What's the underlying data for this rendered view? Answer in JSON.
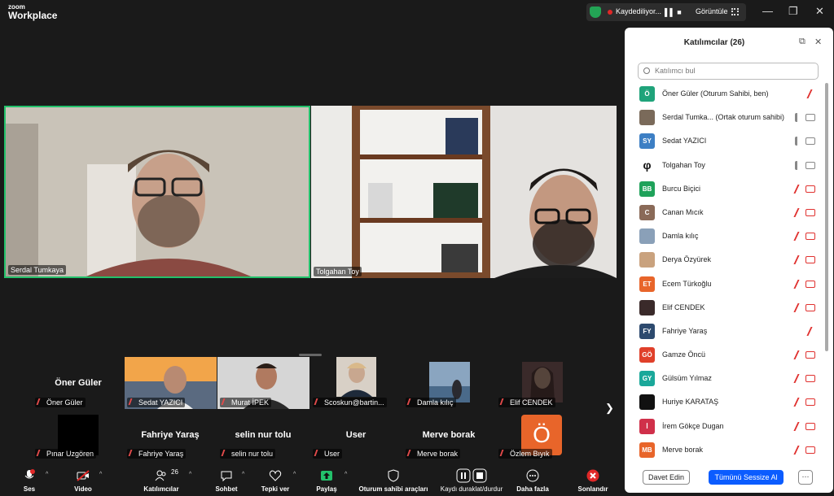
{
  "app": {
    "logo_top": "zoom",
    "logo_bottom": "Workplace"
  },
  "titlebar": {
    "recording": "Kaydediliyor...",
    "recording_controls": "▌▌ ■",
    "view_label": "Görüntüle"
  },
  "main_tiles": [
    {
      "name": "Serdal Tumkaya"
    },
    {
      "name": "Tolgahan Toy"
    }
  ],
  "thumbs_row1": [
    {
      "name": "Öner Güler",
      "big_name": "Öner Güler"
    },
    {
      "name": "Sedat YAZICI"
    },
    {
      "name": "Murat İPEK"
    },
    {
      "name": "Scoskun@bartin..."
    },
    {
      "name": "Damla kılıç"
    },
    {
      "name": "Elif CENDEK"
    }
  ],
  "thumbs_row2": [
    {
      "name": "Pınar Uzgören"
    },
    {
      "name": "Fahriye Yaraş",
      "big_name": "Fahriye Yaraş"
    },
    {
      "name": "selin nur tolu",
      "big_name": "selin nur tolu"
    },
    {
      "name": "User",
      "big_name": "User"
    },
    {
      "name": "Merve borak",
      "big_name": "Merve borak"
    },
    {
      "name": "Özlem Bıyık",
      "avatar_letter": "Ö"
    }
  ],
  "panel": {
    "title": "Katılımcılar (26)",
    "search_placeholder": "Katılımcı bul",
    "invite_label": "Davet Edin",
    "mute_all_label": "Tümünü Sessize Al",
    "more_label": "···",
    "participants": [
      {
        "name": "Öner Güler (Oturum Sahibi, ben)",
        "initials": "Ö",
        "color": "#1fa37a",
        "mic": "off",
        "cam": "none"
      },
      {
        "name": "Serdal Tumka...  (Ortak oturum sahibi)",
        "initials": "",
        "color": "#7a6a5a",
        "mic": "on",
        "cam": "on"
      },
      {
        "name": "Sedat YAZICI",
        "initials": "SY",
        "color": "#3d7fc4",
        "mic": "on",
        "cam": "on"
      },
      {
        "name": "Tolgahan Toy",
        "initials": "φ",
        "color": "#ffffff",
        "mic": "on",
        "cam": "on"
      },
      {
        "name": "Burcu Biçici",
        "initials": "BB",
        "color": "#1fa25a",
        "mic": "off",
        "cam": "off"
      },
      {
        "name": "Canan Mıcık",
        "initials": "C",
        "color": "#8a6a58",
        "mic": "off",
        "cam": "off"
      },
      {
        "name": "Damla kılıç",
        "initials": "",
        "color": "#8aa0b8",
        "mic": "off",
        "cam": "off"
      },
      {
        "name": "Derya Özyürek",
        "initials": "",
        "color": "#c9a27e",
        "mic": "off",
        "cam": "off"
      },
      {
        "name": "Ecem Türkoğlu",
        "initials": "ET",
        "color": "#e8652a",
        "mic": "off",
        "cam": "off"
      },
      {
        "name": "Elif CENDEK",
        "initials": "",
        "color": "#3a2a2a",
        "mic": "off",
        "cam": "off"
      },
      {
        "name": "Fahriye Yaraş",
        "initials": "FY",
        "color": "#2d4a6e",
        "mic": "off",
        "cam": "none"
      },
      {
        "name": "Gamze Öncü",
        "initials": "GÖ",
        "color": "#e0402a",
        "mic": "off",
        "cam": "off"
      },
      {
        "name": "Gülsüm Yılmaz",
        "initials": "GY",
        "color": "#1aa89a",
        "mic": "off",
        "cam": "off"
      },
      {
        "name": "Huriye KARATAŞ",
        "initials": "",
        "color": "#111111",
        "mic": "off",
        "cam": "off"
      },
      {
        "name": "İrem Gökçe Dugan",
        "initials": "İ",
        "color": "#d0304a",
        "mic": "off",
        "cam": "off"
      },
      {
        "name": "Merve borak",
        "initials": "MB",
        "color": "#e8652a",
        "mic": "off",
        "cam": "off"
      }
    ]
  },
  "toolbar": {
    "audio": "Ses",
    "video": "Video",
    "participants": "Katılımcılar",
    "participants_count": "26",
    "chat": "Sohbet",
    "react": "Tepki ver",
    "share": "Paylaş",
    "host_tools": "Oturum sahibi araçları",
    "rec_pause": "Kaydı duraklat/durdur",
    "more": "Daha fazla",
    "end": "Sonlandır"
  },
  "colors": {
    "accent": "#0b5cff",
    "active_speaker": "#23c16b",
    "end_red": "#e02828",
    "share_green": "#23c16b"
  }
}
